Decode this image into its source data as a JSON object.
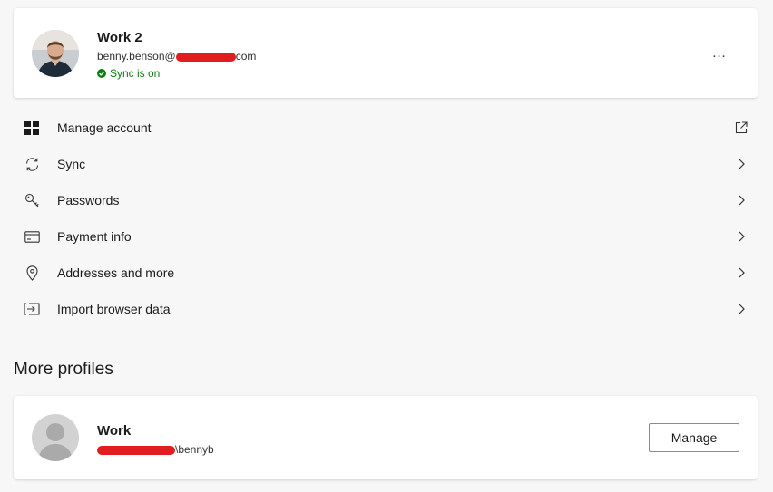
{
  "current_profile": {
    "name": "Work 2",
    "email_prefix": "benny.benson@",
    "email_suffix": "com",
    "sync_status": "Sync is on",
    "more_label": "…"
  },
  "menu": [
    {
      "label": "Manage account",
      "icon": "grid-icon",
      "trailing": "open-external-icon"
    },
    {
      "label": "Sync",
      "icon": "sync-icon",
      "trailing": "chevron-right-icon"
    },
    {
      "label": "Passwords",
      "icon": "key-icon",
      "trailing": "chevron-right-icon"
    },
    {
      "label": "Payment info",
      "icon": "credit-card-icon",
      "trailing": "chevron-right-icon"
    },
    {
      "label": "Addresses and more",
      "icon": "location-pin-icon",
      "trailing": "chevron-right-icon"
    },
    {
      "label": "Import browser data",
      "icon": "import-icon",
      "trailing": "chevron-right-icon"
    }
  ],
  "more_profiles": {
    "title": "More profiles",
    "profiles": [
      {
        "name": "Work",
        "account_suffix": "\\bennyb",
        "manage_label": "Manage"
      }
    ]
  },
  "colors": {
    "page_bg": "#f7f7f7",
    "card_bg": "#ffffff",
    "sync_green": "#107c10",
    "redaction": "#e11d1d"
  }
}
